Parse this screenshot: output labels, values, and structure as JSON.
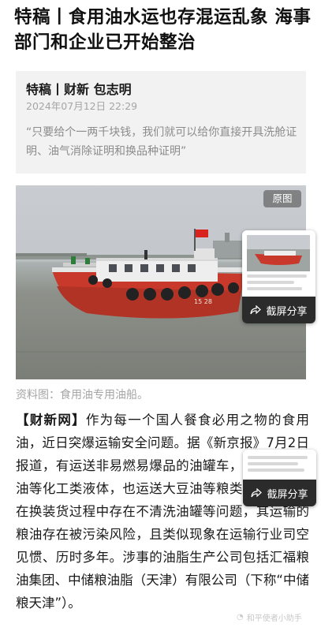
{
  "headline": "特稿丨食用油水运也存混运乱象 海事部门和企业已开始整治",
  "byline": "特稿丨财新 包志明",
  "publish_time": "2024年07月12日 22:29",
  "summary_quote": "“只要给个一两千块钱，我们就可以给你直接开具洗舱证明、油气消除证明和换品种证明”",
  "photo": {
    "original_badge": "原图",
    "hull_number": "15 28"
  },
  "photo_caption": "资料图：食用油专用油船。",
  "article": {
    "source_tag": "【财新网】",
    "body": "作为每一个国人餐食必用之物的食用油，近日突爆运输安全问题。据《新京报》7月2日报道，有运送非易燃易爆品的油罐车，也运送煤制油等化工类液体，也运送大豆油等粮类油品，竟然在换装货过程中存在不清洗油罐等问题，其运输的粮油存在被污染风险，且类似现象在运输行业司空见惯、历时多年。涉事的油脂生产公司包括汇福粮油集团、中储粮油脂（天津）有限公司（下称“中储粮天津”）。"
  },
  "share_cards": [
    {
      "label": "截屏分享",
      "icon": "share-arrow-icon"
    },
    {
      "label": "截屏分享",
      "icon": "share-arrow-icon"
    }
  ],
  "watermark": "和平使者小助手",
  "colors": {
    "hull_red": "#c8392b",
    "card_bg": "#f2f2f2",
    "muted_text": "#a5a5a5",
    "share_bar": "#2b2b2b"
  }
}
